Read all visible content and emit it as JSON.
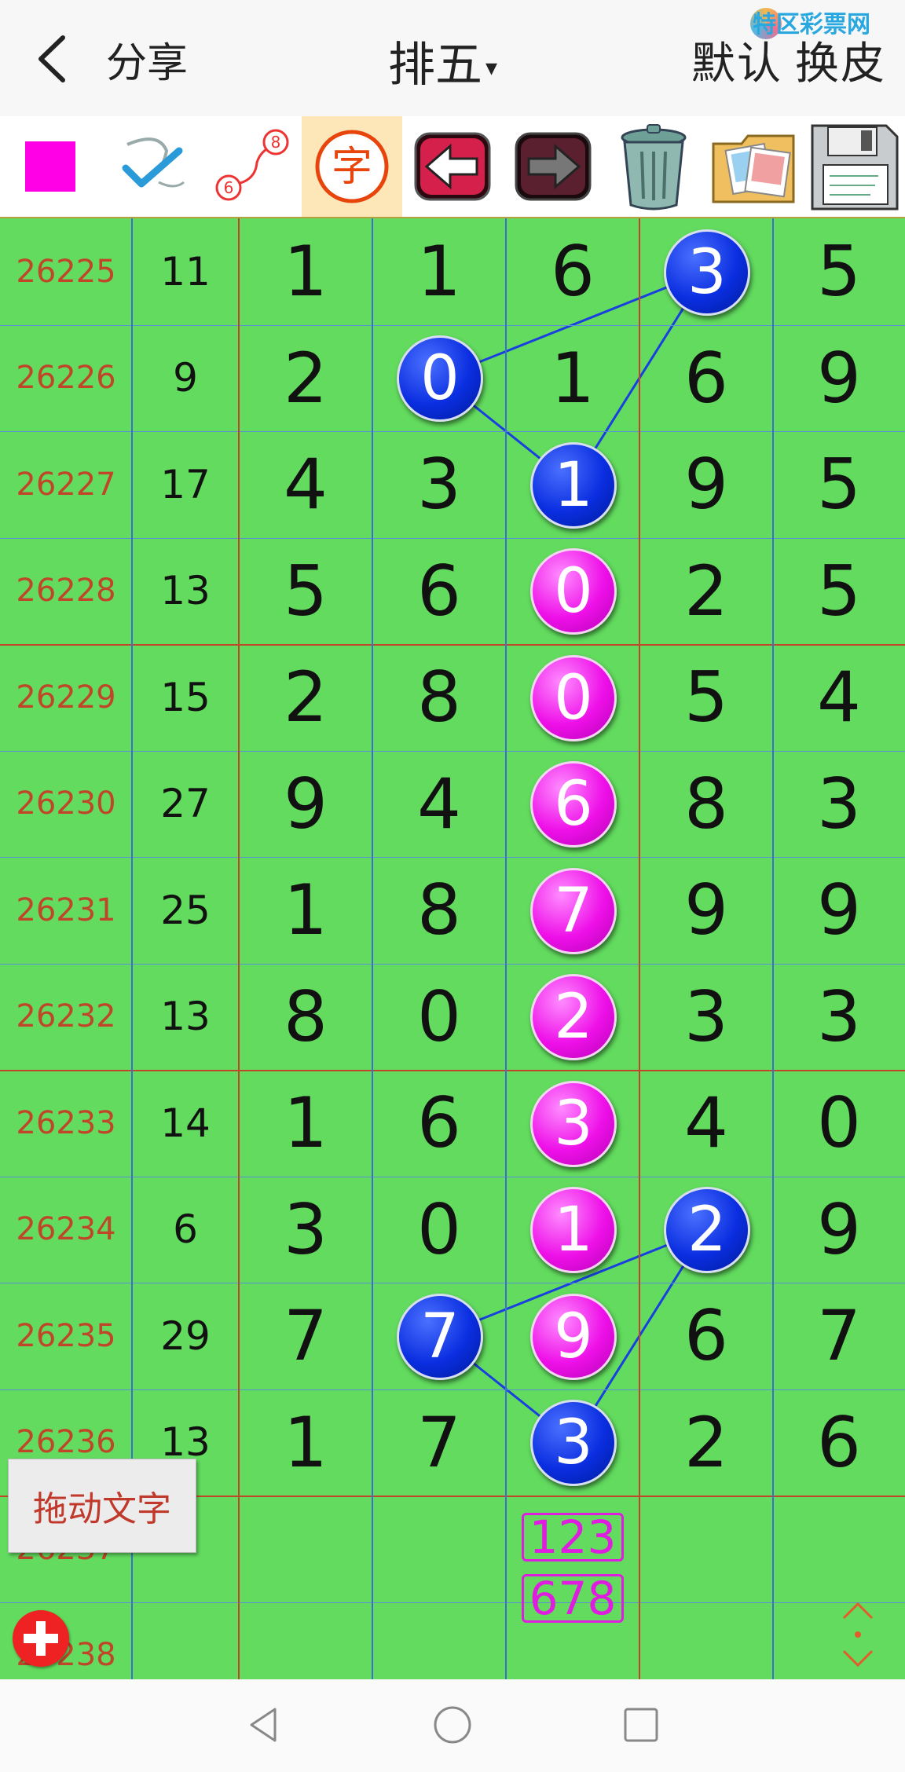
{
  "header": {
    "share_label": "分享",
    "title": "排五",
    "title_caret": "▾",
    "default_label": "默认",
    "skin_label": "换皮",
    "watermark": "特区彩票网"
  },
  "toolbar": {
    "items": [
      "color-swatch",
      "check-mark",
      "line-6-8",
      "char-mode",
      "undo-arrow",
      "redo-arrow",
      "trash",
      "photos",
      "save-floppy"
    ],
    "line_from": "6",
    "line_to": "8",
    "char_label": "字",
    "swatch_color": "#ff00e6"
  },
  "table": {
    "rows": [
      {
        "period": "26225",
        "sum": "11",
        "digits": [
          "1",
          "1",
          "6",
          "3",
          "5"
        ]
      },
      {
        "period": "26226",
        "sum": "9",
        "digits": [
          "2",
          "0",
          "1",
          "6",
          "9"
        ]
      },
      {
        "period": "26227",
        "sum": "17",
        "digits": [
          "4",
          "3",
          "1",
          "9",
          "5"
        ]
      },
      {
        "period": "26228",
        "sum": "13",
        "digits": [
          "5",
          "6",
          "0",
          "2",
          "5"
        ]
      },
      {
        "period": "26229",
        "sum": "15",
        "digits": [
          "2",
          "8",
          "0",
          "5",
          "4"
        ]
      },
      {
        "period": "26230",
        "sum": "27",
        "digits": [
          "9",
          "4",
          "6",
          "8",
          "3"
        ]
      },
      {
        "period": "26231",
        "sum": "25",
        "digits": [
          "1",
          "8",
          "7",
          "9",
          "9"
        ]
      },
      {
        "period": "26232",
        "sum": "13",
        "digits": [
          "8",
          "0",
          "2",
          "3",
          "3"
        ]
      },
      {
        "period": "26233",
        "sum": "14",
        "digits": [
          "1",
          "6",
          "3",
          "4",
          "0"
        ]
      },
      {
        "period": "26234",
        "sum": "6",
        "digits": [
          "3",
          "0",
          "1",
          "2",
          "9"
        ]
      },
      {
        "period": "26235",
        "sum": "29",
        "digits": [
          "7",
          "7",
          "9",
          "6",
          "7"
        ]
      },
      {
        "period": "26236",
        "sum": "13",
        "digits": [
          "1",
          "7",
          "3",
          "2",
          "6"
        ]
      },
      {
        "period": "26237",
        "sum": "",
        "digits": [
          "",
          "",
          "",
          "",
          ""
        ]
      },
      {
        "period": "26238",
        "sum": "",
        "digits": [
          "",
          "",
          "",
          "",
          ""
        ]
      }
    ],
    "highlights": [
      {
        "row": 0,
        "col": 3,
        "style": "blue"
      },
      {
        "row": 1,
        "col": 1,
        "style": "blue"
      },
      {
        "row": 2,
        "col": 2,
        "style": "blue"
      },
      {
        "row": 3,
        "col": 2,
        "style": "magenta"
      },
      {
        "row": 4,
        "col": 2,
        "style": "magenta"
      },
      {
        "row": 5,
        "col": 2,
        "style": "magenta"
      },
      {
        "row": 6,
        "col": 2,
        "style": "magenta"
      },
      {
        "row": 7,
        "col": 2,
        "style": "magenta"
      },
      {
        "row": 8,
        "col": 2,
        "style": "magenta"
      },
      {
        "row": 9,
        "col": 2,
        "style": "magenta"
      },
      {
        "row": 9,
        "col": 3,
        "style": "blue"
      },
      {
        "row": 10,
        "col": 1,
        "style": "blue"
      },
      {
        "row": 10,
        "col": 2,
        "style": "magenta"
      },
      {
        "row": 11,
        "col": 2,
        "style": "blue"
      }
    ],
    "prediction": [
      "123",
      "678"
    ],
    "colors": {
      "period": "#c0462a",
      "grid": "#62db5e",
      "magenta": "#ee10e8",
      "blue": "#0a2ee0",
      "line": "#1a3fe0"
    }
  },
  "drag_text_label": "拖动文字",
  "add_icon": "plus-circle-icon",
  "nav": [
    "back-triangle-icon",
    "home-circle-icon",
    "recent-square-icon"
  ]
}
